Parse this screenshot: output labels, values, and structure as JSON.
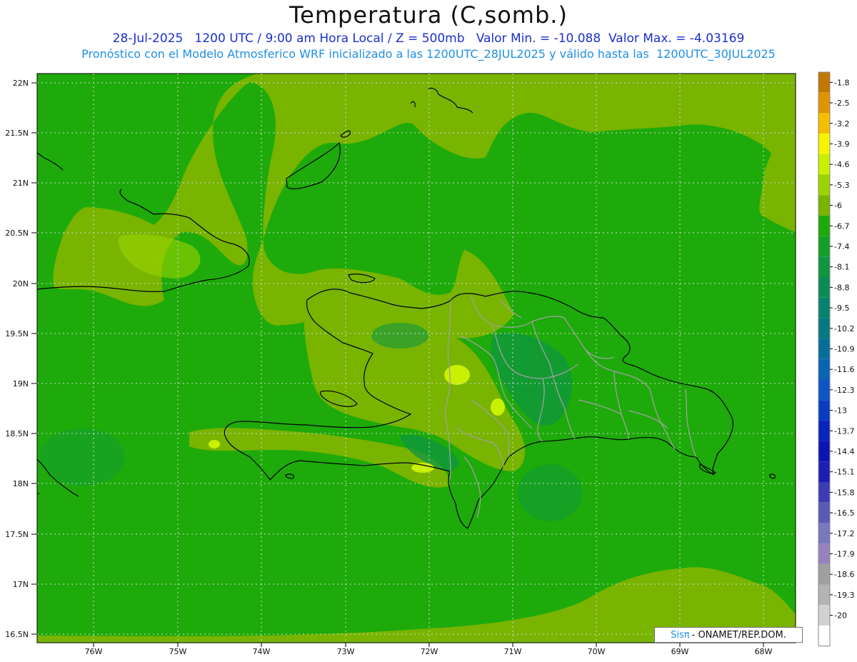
{
  "title": "Temperatura (C,somb.)",
  "subtitle_line1": "28-Jul-2025   1200 UTC / 9:00 am Hora Local / Z = 500mb   Valor Min. = -10.088  Valor Max. = -4.03169",
  "subtitle_line2": "Pronóstico con el Modelo Atmosferico WRF inicializado a las 1200UTC_28JUL2025 y válido hasta las  1200UTC_30JUL2025",
  "credit": {
    "sis": "Sisπ",
    "rest": "- ONAMET/REP.DOM."
  },
  "axes": {
    "lat_labels": [
      "22N",
      "21.5N",
      "21N",
      "20.5N",
      "20N",
      "19.5N",
      "19N",
      "18.5N",
      "18N",
      "17.5N",
      "17N",
      "16.5N"
    ],
    "lon_labels": [
      "76W",
      "75W",
      "74W",
      "73W",
      "72W",
      "71W",
      "70W",
      "69W",
      "68W"
    ]
  },
  "colorbar": {
    "labels": [
      "-1.8",
      "-2.5",
      "-3.2",
      "-3.9",
      "-4.6",
      "-5.3",
      "-6",
      "-6.7",
      "-7.4",
      "-8.1",
      "-8.8",
      "-9.5",
      "-10.2",
      "-10.9",
      "-11.6",
      "-12.3",
      "-13",
      "-13.7",
      "-14.4",
      "-15.1",
      "-15.8",
      "-16.5",
      "-17.2",
      "-17.9",
      "-18.6",
      "-19.3",
      "-20"
    ],
    "colors": [
      "#c07800",
      "#e09400",
      "#f5be00",
      "#f5f500",
      "#c8f000",
      "#9bd400",
      "#78b400",
      "#1eaa0a",
      "#14a028",
      "#0f9641",
      "#0a8c55",
      "#07826e",
      "#057882",
      "#056e9b",
      "#0a64b4",
      "#0f55c3",
      "#0a3cc3",
      "#0a23be",
      "#0a14b4",
      "#1e1eb4",
      "#3c3cb4",
      "#5a5ab4",
      "#7878be",
      "#9682be",
      "#a0a0a0",
      "#b4b4b4",
      "#d2d2d2"
    ],
    "bottom_color": "#ffffff"
  },
  "colors": {
    "base_field": "#1eaa0a",
    "warm_field": "#78b400",
    "yellow_green": "#c8f000",
    "cool_field": "#0f9641",
    "coast": "#000000",
    "province_border": "#a0a0a0"
  }
}
